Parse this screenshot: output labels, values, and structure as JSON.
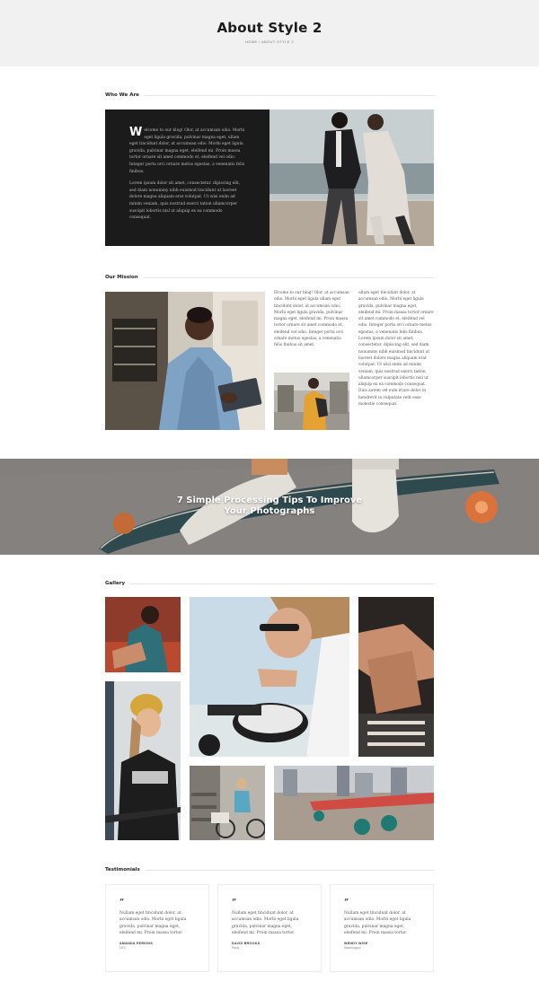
{
  "hero": {
    "title": "About Style 2",
    "breadcrumb": {
      "home": "HOME",
      "separator": "/",
      "current": "ABOUT STYLE 2"
    }
  },
  "sections": {
    "who": "Who We Are",
    "mission": "Our Mission",
    "gallery": "Gallery",
    "testimonials": "Testimonials"
  },
  "who": {
    "dropcap": "W",
    "p1": "elcome to our blog! Olor, at accumsan odio. Morbi eget ligula gravida, pulvinar magna eget, ullam eget tincidunt dolor, at accumsan odio. Morbi eget ligula gravida, pulvinar magna eget, eleifend mi. Proin massa tortor ornare sit amet commodo et, eleifend vel odio. Integer porta orci ornare metus egestas, a venenatis felis finibus.",
    "p2": "Lorem ipsum dolor sit amet, consectetur. dipiscing elit, sed diam nonummy nibh euismod tincidunt ut laoreet dolore magna aliquam erat volutpat. Ut wisi enim ad minim veniam, quis nostrud exerci tation ullamcorper suscipit lobortis nisl ut aliquip ex ea commodo consequat."
  },
  "mission": {
    "col1": "Elcome to our blog! Olor, at accumsan odio. Morbi eget ligula ullam eget tincidunt dolor, at accumsan odio. Morbi eget ligula gravida, pulvinar magna eget, eleifend mi. Proin massa tortor ornare sit amet commodo et, eleifend vel odio. Integer porta orci ornare metus egestas, a venenatis felis finibus sit amet.",
    "col2": "ullam eget tincidunt dolor, at accumsan odio. Morbi eget ligula gravida, pulvinar magna eget, eleifend mi. Proin massa tortor ornare sit amet commodo et, eleifend vel odio. Integer porta orci ornare metus egestas, a venenatis felis finibus. Lorem ipsum dolor sit amet, consectetur. dipiscing elit, sed diam nonummy nibh euismod tincidunt ut laoreet dolore magna aliquam erat volutpat. Ut wisi enim ad minim veniam, quis nostrud exerci tation ullamcorper suscipit lobortis nisl ut aliquip ex ea commodo consequat. Duis autem vel eum iriure dolor in hendrerit in vulputate velit esse molestie consequat."
  },
  "banner": {
    "line1": "7 Simple Processing Tips To Improve",
    "line2": "Your Photographs"
  },
  "testimonials": [
    {
      "quote_mark": "”",
      "text": "Nullam eget tincidunt dolor, at accumsan odio. Morbi eget ligula gravida, pulvinar magna eget, eleifend mi. Proin massa tortor.",
      "name": "AMANDA PERKINS",
      "role": "NYC"
    },
    {
      "quote_mark": "”",
      "text": "Nullam eget tincidunt dolor, at accumsan odio. Morbi eget ligula gravida, pulvinar magna eget, eleifend mi. Proin massa tortor.",
      "name": "DAVID BROOKS",
      "role": "Paris"
    },
    {
      "quote_mark": "”",
      "text": "Nullam eget tincidunt dolor, at accumsan odio. Morbi eget ligula gravida, pulvinar magna eget, eleifend mi. Proin massa tortor.",
      "name": "WENDY WISE",
      "role": "Washington"
    }
  ],
  "colors": {
    "hero_bg": "#f1f1f1",
    "dark_panel": "#1b1b1b",
    "rule": "#e4e4e4",
    "card_border": "#ececec"
  }
}
